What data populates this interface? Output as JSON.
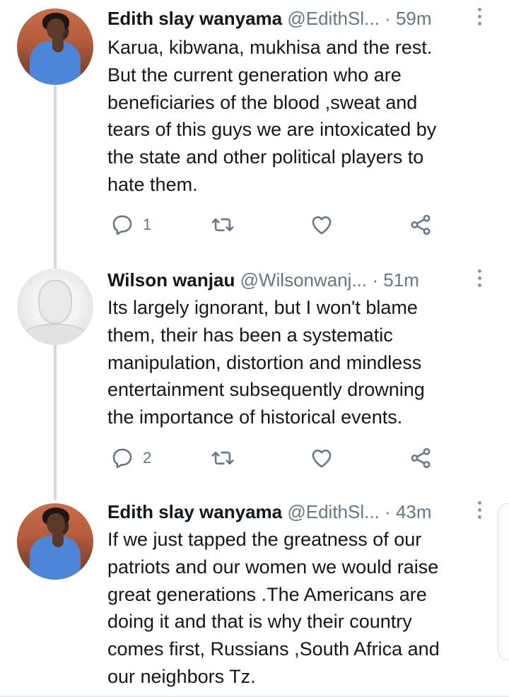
{
  "tweets": [
    {
      "name": "Edith slay wanyama",
      "handle": "@EdithSl...",
      "separator": "·",
      "time": "59m",
      "text": "Karua, kibwana, mukhisa  and the rest.\nBut the current generation who are\nbeneficiaries of the blood ,sweat and\ntears of this guys we are intoxicated by\nthe state and other  political players to\nhate them.",
      "reply_count": "1"
    },
    {
      "name": "Wilson wanjau",
      "handle": "@Wilsonwanj...",
      "separator": "·",
      "time": "51m",
      "text": "Its largely ignorant, but I won't blame\nthem, their has been a systematic\nmanipulation, distortion and mindless\nentertainment subsequently drowning\nthe importance of historical events.",
      "reply_count": "2"
    },
    {
      "name": "Edith slay wanyama",
      "handle": "@EdithSl...",
      "separator": "·",
      "time": "43m",
      "text": "If we just tapped the greatness of our\npatriots and our women we would raise\ngreat generations  .The Americans are\ndoing it and that is why their country\ncomes first, Russians ,South Africa and\nour neighbors Tz."
    }
  ],
  "icons": {
    "reply": "reply-icon",
    "retweet": "retweet-icon",
    "like": "heart-icon",
    "share": "share-icon",
    "more": "more-vertical-icon"
  },
  "colors": {
    "text": "#14171a",
    "muted": "#657786",
    "thread_line": "#cfd9de"
  }
}
